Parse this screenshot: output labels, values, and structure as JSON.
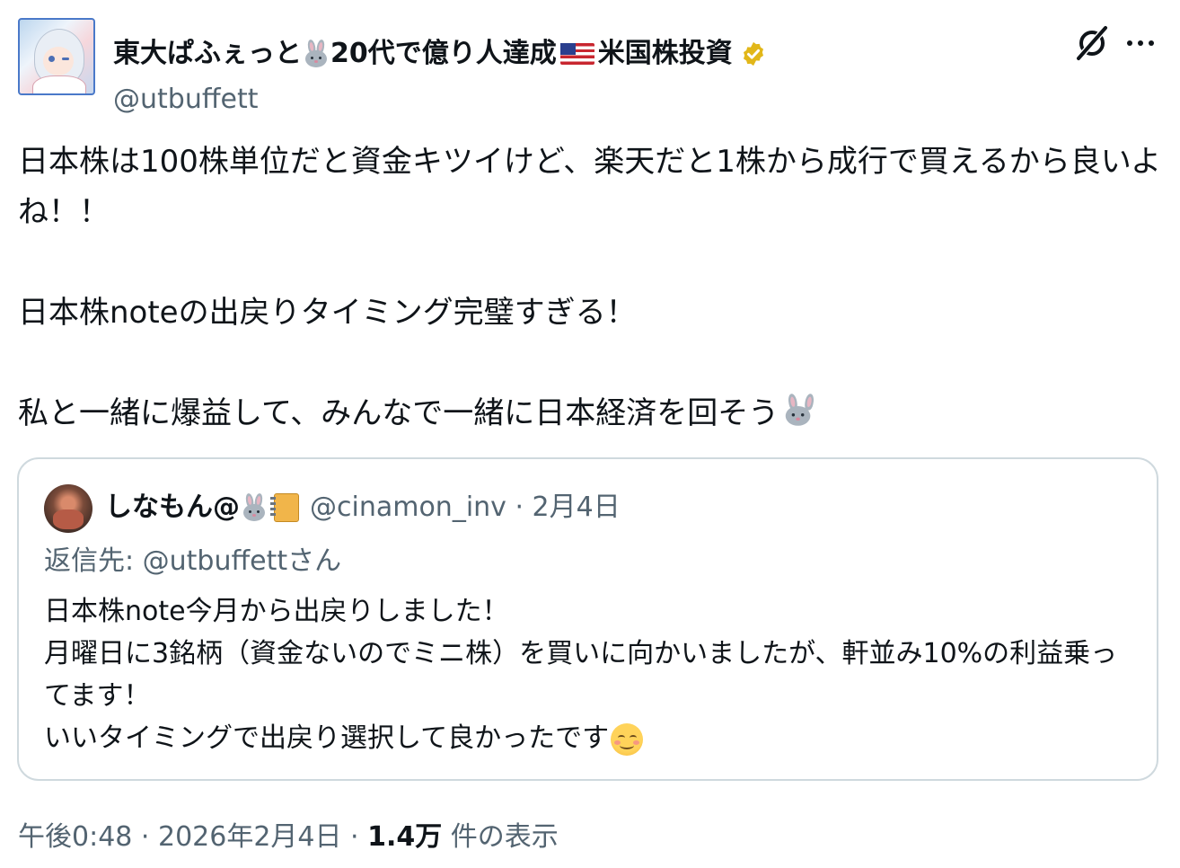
{
  "author": {
    "name_part1": "東大ぱふぇっと",
    "name_part2": "20代で億り人達成",
    "name_part3": "米国株投資",
    "handle": "@utbuffett",
    "name_emojis": [
      "rabbit-icon",
      "us-flag-icon",
      "verified-badge-icon"
    ]
  },
  "header_actions": {
    "grok_icon": "grok-icon",
    "more_label": "···"
  },
  "tweet": {
    "line1": "日本株は100株単位だと資金キツイけど、楽天だと1株から成行で買えるから良いよね！！",
    "line2": "日本株noteの出戻りタイミング完璧すぎる！",
    "line3": "私と一緒に爆益して、みんなで一緒に日本経済を回そう"
  },
  "quote": {
    "name": "しなもん@",
    "handle_date": "@cinamon_inv · 2月4日",
    "reply_to": "返信先: @utbuffettさん",
    "text": "日本株note今月から出戻りしました！\n月曜日に3銘柄（資金ないのでミニ株）を買いに向かいましたが、軒並み10%の利益乗ってます！\nいいタイミングで出戻り選択して良かったです"
  },
  "footer": {
    "time_date": "午後0:48 · 2026年2月4日 · ",
    "views_count": "1.4万",
    "views_label": " 件の表示"
  },
  "colors": {
    "text": "#0f1419",
    "secondary": "#536471",
    "border": "#cfd9de",
    "verified_gold": "#e2b719"
  }
}
